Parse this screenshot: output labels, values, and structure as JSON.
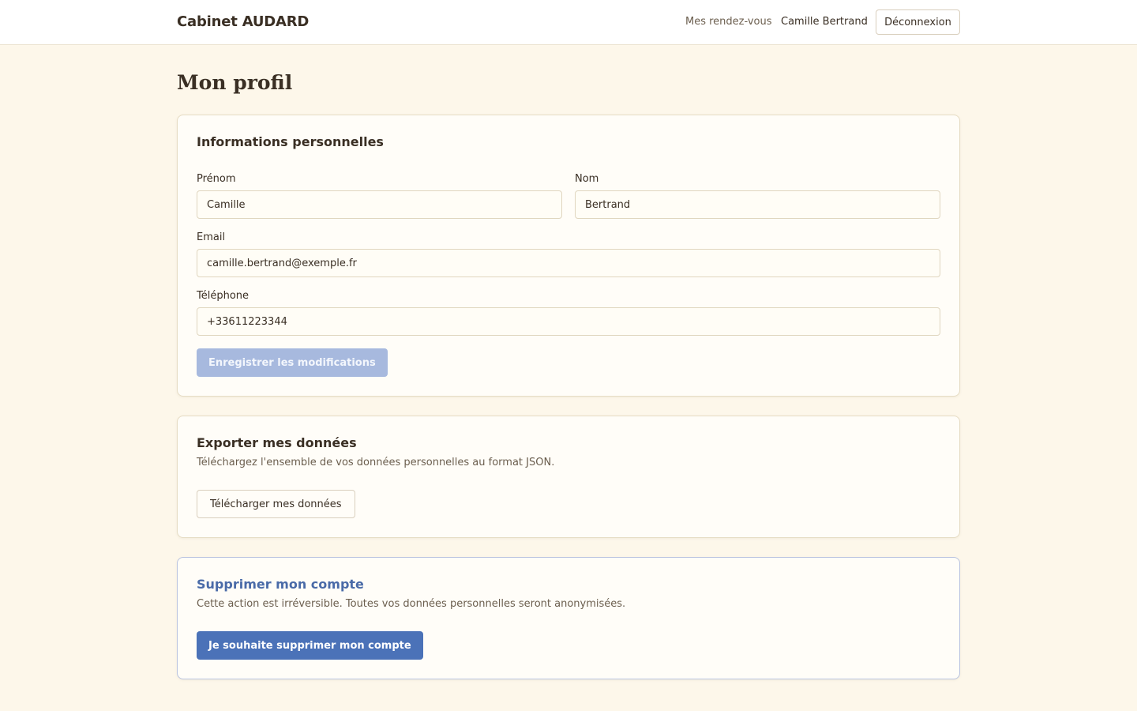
{
  "header": {
    "brand": "Cabinet AUDARD",
    "nav_appointments": "Mes rendez-vous",
    "user_name": "Camille Bertrand",
    "logout_label": "Déconnexion"
  },
  "page": {
    "title": "Mon profil"
  },
  "personal_info": {
    "title": "Informations personnelles",
    "first_name_label": "Prénom",
    "first_name_value": "Camille",
    "last_name_label": "Nom",
    "last_name_value": "Bertrand",
    "email_label": "Email",
    "email_value": "camille.bertrand@exemple.fr",
    "phone_label": "Téléphone",
    "phone_value": "+33611223344",
    "save_label": "Enregistrer les modifications"
  },
  "export": {
    "title": "Exporter mes données",
    "description": "Téléchargez l'ensemble de vos données personnelles au format JSON.",
    "button_label": "Télécharger mes données"
  },
  "delete_account": {
    "title": "Supprimer mon compte",
    "description": "Cette action est irréversible. Toutes vos données personnelles seront anonymisées.",
    "button_label": "Je souhaite supprimer mon compte"
  },
  "colors": {
    "background": "#fdf7ea",
    "primary": "#4b72b8",
    "primary_disabled": "#a7b9de",
    "danger_title": "#4a6ba8"
  }
}
